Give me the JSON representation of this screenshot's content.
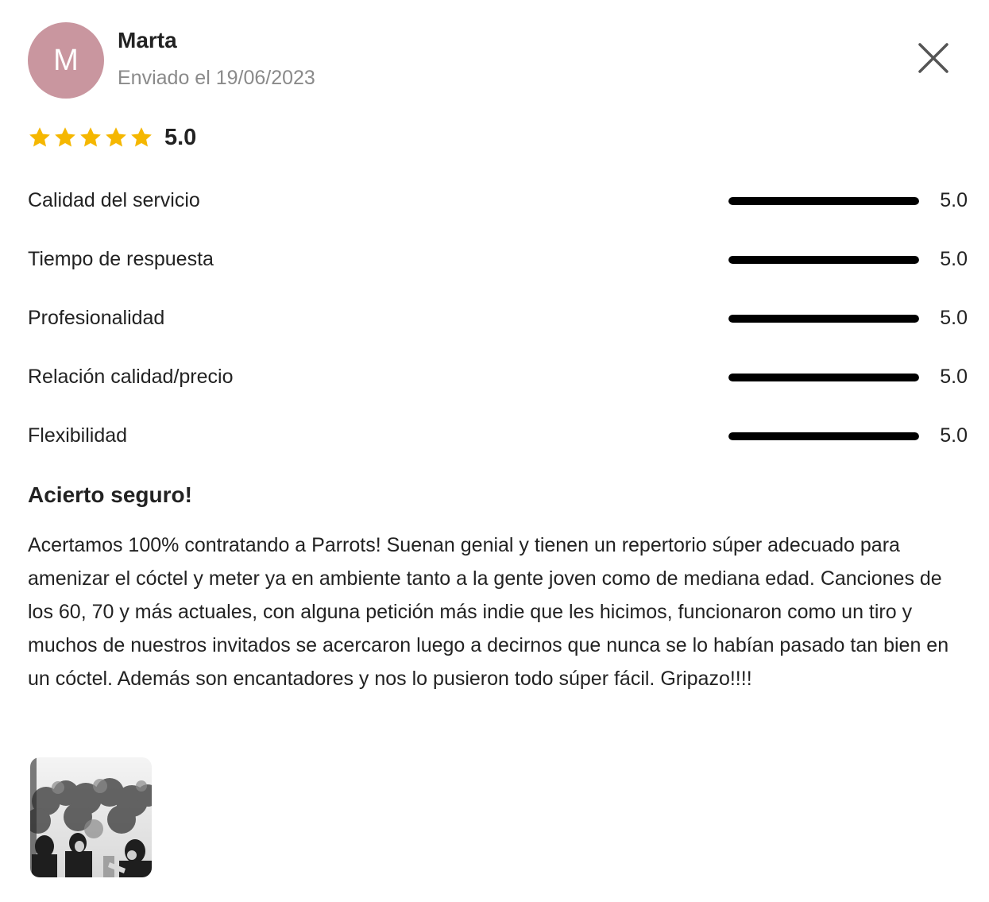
{
  "review": {
    "author": {
      "initial": "M",
      "name": "Marta",
      "avatar_color": "#c9969f",
      "sent_date": "Enviado el 19/06/2023"
    },
    "close_icon": "close-icon",
    "overall": {
      "stars": 5,
      "max_stars": 5,
      "star_color": "#f5b700",
      "score": "5.0"
    },
    "criteria": [
      {
        "label": "Calidad del servicio",
        "score": "5.0",
        "fraction": 1.0
      },
      {
        "label": "Tiempo de respuesta",
        "score": "5.0",
        "fraction": 1.0
      },
      {
        "label": "Profesionalidad",
        "score": "5.0",
        "fraction": 1.0
      },
      {
        "label": "Relación calidad/precio",
        "score": "5.0",
        "fraction": 1.0
      },
      {
        "label": "Flexibilidad",
        "score": "5.0",
        "fraction": 1.0
      }
    ],
    "title": "Acierto seguro!",
    "body": "Acertamos 100% contratando a Parrots! Suenan genial y tienen un repertorio súper adecuado para amenizar el cóctel y meter ya en ambiente tanto a la gente joven como de mediana edad. Canciones de los 60, 70 y más actuales, con alguna petición más indie que les hicimos, funcionaron como un tiro y muchos de nuestros invitados se acercaron luego a decirnos que nunca se lo habían pasado tan bien en un cóctel. Además son encantadores y nos lo pusieron todo súper fácil. Gripazo!!!!",
    "photos": [
      {
        "type": "thumbnail"
      }
    ]
  }
}
